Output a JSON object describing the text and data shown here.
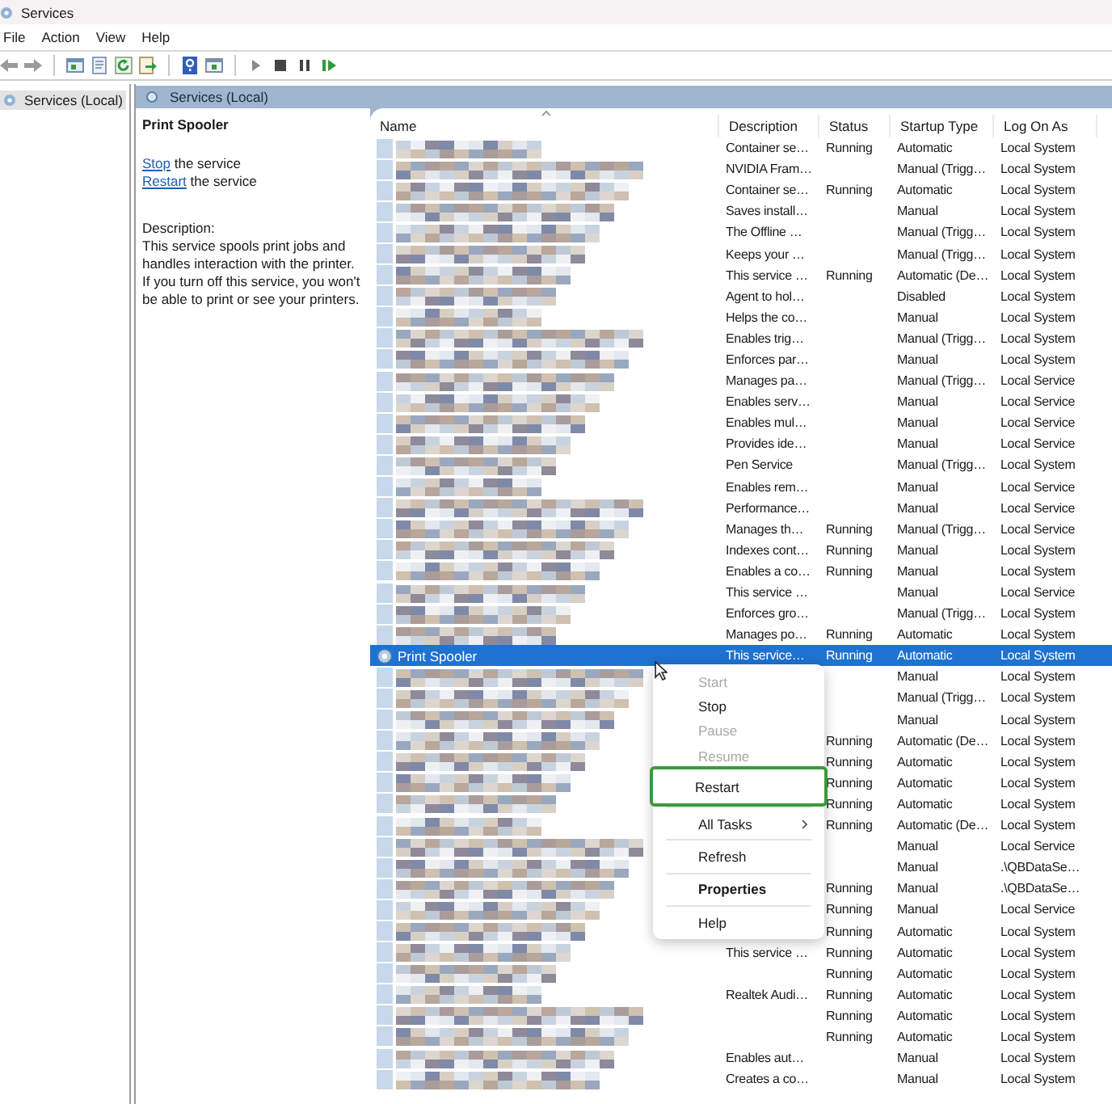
{
  "window": {
    "title": "Services"
  },
  "menu_bar": [
    "File",
    "Action",
    "View",
    "Help"
  ],
  "tree": {
    "items": [
      {
        "label": "Services (Local)",
        "selected": true
      }
    ]
  },
  "panel": {
    "title": "Services (Local)"
  },
  "details": {
    "service_name": "Print Spooler",
    "actions": [
      {
        "link": "Stop",
        "text": "the service"
      },
      {
        "link": "Restart",
        "text": "the service"
      }
    ],
    "description_label": "Description:",
    "description": "This service spools print jobs and handles interaction with the printer. If you turn off this service, you won't be able to print or see your printers."
  },
  "table": {
    "columns": [
      "Name",
      "Description",
      "Status",
      "Startup Type",
      "Log On As"
    ],
    "rows": [
      {
        "name_hidden": true,
        "description": "Container se…",
        "status": "Running",
        "startup": "Automatic",
        "log_on": "Local System",
        "selected": false
      },
      {
        "name_hidden": true,
        "description": "NVIDIA Fram…",
        "startup": "Manual (Trigg…",
        "log_on": "Local System",
        "selected": false
      },
      {
        "name_hidden": true,
        "description": "Container se…",
        "status": "Running",
        "startup": "Automatic",
        "log_on": "Local System",
        "selected": false
      },
      {
        "name_hidden": true,
        "description": "Saves install…",
        "startup": "Manual",
        "log_on": "Local System",
        "selected": false
      },
      {
        "name_hidden": true,
        "description": "The Offline …",
        "startup": "Manual (Trigg…",
        "log_on": "Local System",
        "selected": false
      },
      {
        "name_hidden": true,
        "description": "Keeps your …",
        "startup": "Manual (Trigg…",
        "log_on": "Local System",
        "selected": false
      },
      {
        "name_hidden": true,
        "description": "This service …",
        "status": "Running",
        "startup": "Automatic (De…",
        "log_on": "Local System",
        "selected": false
      },
      {
        "name_hidden": true,
        "description": "Agent to hol…",
        "startup": "Disabled",
        "log_on": "Local System",
        "selected": false
      },
      {
        "name_hidden": true,
        "description": "Helps the co…",
        "startup": "Manual",
        "log_on": "Local System",
        "selected": false
      },
      {
        "name_hidden": true,
        "description": "Enables trig…",
        "startup": "Manual (Trigg…",
        "log_on": "Local System",
        "selected": false
      },
      {
        "name_hidden": true,
        "description": "Enforces par…",
        "startup": "Manual",
        "log_on": "Local System",
        "selected": false
      },
      {
        "name_hidden": true,
        "description": "Manages pa…",
        "startup": "Manual (Trigg…",
        "log_on": "Local Service",
        "selected": false
      },
      {
        "name_hidden": true,
        "description": "Enables serv…",
        "startup": "Manual",
        "log_on": "Local Service",
        "selected": false
      },
      {
        "name_hidden": true,
        "description": "Enables mul…",
        "startup": "Manual",
        "log_on": "Local Service",
        "selected": false
      },
      {
        "name_hidden": true,
        "description": "Provides ide…",
        "startup": "Manual",
        "log_on": "Local Service",
        "selected": false
      },
      {
        "name_hidden": true,
        "description": "Pen Service",
        "startup": "Manual (Trigg…",
        "log_on": "Local System",
        "selected": false
      },
      {
        "name_hidden": true,
        "description": "Enables rem…",
        "startup": "Manual",
        "log_on": "Local Service",
        "selected": false
      },
      {
        "name_hidden": true,
        "description": "Performance…",
        "startup": "Manual",
        "log_on": "Local Service",
        "selected": false
      },
      {
        "name_hidden": true,
        "description": "Manages th…",
        "status": "Running",
        "startup": "Manual (Trigg…",
        "log_on": "Local Service",
        "selected": false
      },
      {
        "name_hidden": true,
        "description": "Indexes cont…",
        "status": "Running",
        "startup": "Manual",
        "log_on": "Local System",
        "selected": false
      },
      {
        "name_hidden": true,
        "description": "Enables a co…",
        "status": "Running",
        "startup": "Manual",
        "log_on": "Local System",
        "selected": false
      },
      {
        "name_hidden": true,
        "description": "This service …",
        "startup": "Manual",
        "log_on": "Local Service",
        "selected": false
      },
      {
        "name_hidden": true,
        "description": "Enforces gro…",
        "startup": "Manual (Trigg…",
        "log_on": "Local System",
        "selected": false
      },
      {
        "name_hidden": true,
        "description": "Manages po…",
        "status": "Running",
        "startup": "Automatic",
        "log_on": "Local System",
        "selected": false
      },
      {
        "name_hidden": false,
        "name": "Print Spooler",
        "description": "This service…",
        "status": "Running",
        "startup": "Automatic",
        "log_on": "Local System",
        "selected": true
      },
      {
        "name_hidden": true,
        "startup": "Manual",
        "log_on": "Local System",
        "selected": false
      },
      {
        "name_hidden": true,
        "startup": "Manual (Trigg…",
        "log_on": "Local System",
        "selected": false
      },
      {
        "name_hidden": true,
        "startup": "Manual",
        "log_on": "Local System",
        "selected": false
      },
      {
        "name_hidden": true,
        "status": "Running",
        "startup": "Automatic (De…",
        "log_on": "Local System",
        "selected": false
      },
      {
        "name_hidden": true,
        "status": "Running",
        "startup": "Automatic",
        "log_on": "Local System",
        "selected": false
      },
      {
        "name_hidden": true,
        "status": "Running",
        "startup": "Automatic",
        "log_on": "Local System",
        "selected": false
      },
      {
        "name_hidden": true,
        "status": "Running",
        "startup": "Automatic",
        "log_on": "Local System",
        "selected": false
      },
      {
        "name_hidden": true,
        "status": "Running",
        "startup": "Automatic (De…",
        "log_on": "Local System",
        "selected": false
      },
      {
        "name_hidden": true,
        "startup": "Manual",
        "log_on": "Local Service",
        "selected": false
      },
      {
        "name_hidden": true,
        "startup": "Manual",
        "log_on": ".\\QBDataSe…",
        "selected": false
      },
      {
        "name_hidden": true,
        "status": "Running",
        "startup": "Manual",
        "log_on": ".\\QBDataSe…",
        "selected": false
      },
      {
        "name_hidden": true,
        "status": "Running",
        "startup": "Manual",
        "log_on": "Local Service",
        "selected": false
      },
      {
        "name_hidden": true,
        "status": "Running",
        "startup": "Automatic",
        "log_on": "Local System",
        "selected": false
      },
      {
        "name_hidden": true,
        "description": "This service …",
        "status": "Running",
        "startup": "Automatic",
        "log_on": "Local System",
        "selected": false
      },
      {
        "name_hidden": true,
        "status": "Running",
        "startup": "Automatic",
        "log_on": "Local System",
        "selected": false
      },
      {
        "name_hidden": true,
        "description": "Realtek Audi…",
        "status": "Running",
        "startup": "Automatic",
        "log_on": "Local System",
        "selected": false
      },
      {
        "name_hidden": true,
        "status": "Running",
        "startup": "Automatic",
        "log_on": "Local System",
        "selected": false
      },
      {
        "name_hidden": true,
        "status": "Running",
        "startup": "Automatic",
        "log_on": "Local System",
        "selected": false
      },
      {
        "name_hidden": true,
        "description": "Enables aut…",
        "startup": "Manual",
        "log_on": "Local System",
        "selected": false
      },
      {
        "name_hidden": true,
        "description": "Creates a co…",
        "startup": "Manual",
        "log_on": "Local System",
        "selected": false
      }
    ]
  },
  "context_menu": {
    "items": [
      {
        "kind": "item",
        "label": "Start",
        "disabled": true,
        "highlighted": false,
        "bold": false,
        "submenu": false
      },
      {
        "kind": "item",
        "label": "Stop",
        "disabled": false,
        "highlighted": false,
        "bold": false,
        "submenu": false
      },
      {
        "kind": "item",
        "label": "Pause",
        "disabled": true,
        "highlighted": false,
        "bold": false,
        "submenu": false
      },
      {
        "kind": "item",
        "label": "Resume",
        "disabled": true,
        "highlighted": false,
        "bold": false,
        "submenu": false
      },
      {
        "kind": "item",
        "label": "Restart",
        "disabled": false,
        "highlighted": true,
        "bold": false,
        "submenu": false
      },
      {
        "kind": "separator"
      },
      {
        "kind": "item",
        "label": "All Tasks",
        "disabled": false,
        "highlighted": false,
        "bold": false,
        "submenu": true
      },
      {
        "kind": "separator"
      },
      {
        "kind": "item",
        "label": "Refresh",
        "disabled": false,
        "highlighted": false,
        "bold": false,
        "submenu": false
      },
      {
        "kind": "separator"
      },
      {
        "kind": "item",
        "label": "Properties",
        "disabled": false,
        "highlighted": false,
        "bold": true,
        "submenu": false
      },
      {
        "kind": "separator"
      },
      {
        "kind": "item",
        "label": "Help",
        "disabled": false,
        "highlighted": false,
        "bold": false,
        "submenu": false
      }
    ]
  }
}
